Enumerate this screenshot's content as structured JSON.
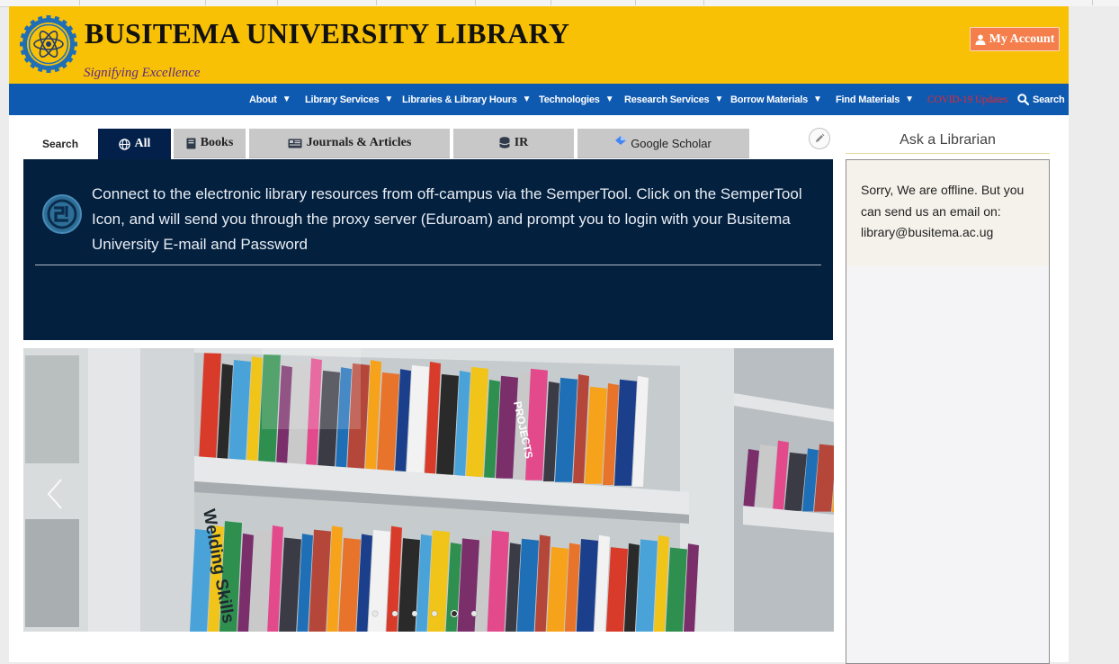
{
  "header": {
    "title": "BUSITEMA UNIVERSITY LIBRARY",
    "tagline": "Signifying Excellence",
    "account_label": "My Account",
    "logo_icon": "atom-gear-logo-icon",
    "colors": {
      "header_bg": "#f9c106",
      "account_bg": "#f47f4c",
      "tagline": "#5a2a8a"
    }
  },
  "nav": {
    "bg_color": "#0f5ab1",
    "items": [
      {
        "label": "About",
        "dropdown": true
      },
      {
        "label": "Library Services",
        "dropdown": true
      },
      {
        "label": "Libraries & Library Hours",
        "dropdown": true
      },
      {
        "label": "Technologies",
        "dropdown": true
      },
      {
        "label": "Research Services",
        "dropdown": true
      },
      {
        "label": "Borrow Materials",
        "dropdown": true
      },
      {
        "label": "Find Materials",
        "dropdown": true
      },
      {
        "label": "COVID-19 Updates",
        "dropdown": false,
        "color": "#e8252b"
      },
      {
        "label": "Search",
        "dropdown": false,
        "icon": "search-icon"
      }
    ]
  },
  "search": {
    "label": "Search",
    "tabs": [
      {
        "label": "All",
        "icon": "globe-icon",
        "active": true
      },
      {
        "label": "Books",
        "icon": "book-icon",
        "active": false
      },
      {
        "label": "Journals & Articles",
        "icon": "newspaper-icon",
        "active": false
      },
      {
        "label": "IR",
        "icon": "database-icon",
        "active": false
      },
      {
        "label": "Google Scholar",
        "icon": "scholar-icon",
        "active": false
      }
    ],
    "active_color": "#03204a"
  },
  "panel": {
    "text": "Connect to the electronic library resources from off-campus via the SemperTool. Click on the SemperTool Icon, and will send you through the proxy server (Eduroam) and prompt you to login with your Busitema University E-mail and Password",
    "icon": "sempertool-icon",
    "bg_color": "#03203f"
  },
  "carousel": {
    "image_subject": "library bookshelf photo",
    "visible_book_spine_text": [
      "Welding Skills",
      "PROJECTS"
    ],
    "slide_count": 6,
    "active_slide": 5
  },
  "sidebar": {
    "title": "Ask a Librarian",
    "chat_message": "Sorry, We are offline. But you can send us an email on: library@busitema.ac.ug"
  }
}
